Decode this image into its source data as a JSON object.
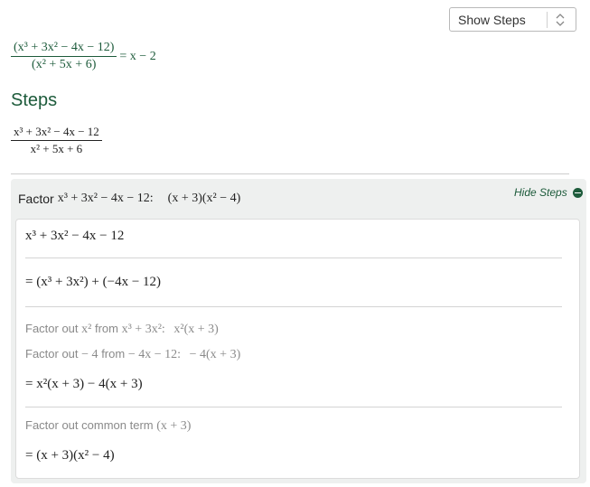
{
  "toolbar": {
    "show_steps_label": "Show Steps"
  },
  "answer": {
    "num": "(x³ + 3x² − 4x − 12)",
    "den": "(x² + 5x + 6)",
    "equals": "= x − 2"
  },
  "steps_title": "Steps",
  "expression": {
    "num": "x³ + 3x² − 4x − 12",
    "den": "x² + 5x + 6"
  },
  "step": {
    "factor_word": "Factor",
    "factor_expr": "x³ + 3x² − 4x − 12:",
    "factor_result": "(x + 3)(x² − 4)",
    "hide_steps_label": "Hide Steps",
    "lines": {
      "l1": "x³ + 3x² − 4x − 12",
      "l2": "= (x³ + 3x²) + (−4x − 12)",
      "n1_word": "Factor out",
      "n1_term": "x²",
      "n1_from": "from",
      "n1_expr": "x³ + 3x²:",
      "n1_result": "x²(x + 3)",
      "n2_word": "Factor out",
      "n2_term": "− 4",
      "n2_from": "from",
      "n2_expr": "− 4x − 12:",
      "n2_result": "− 4(x + 3)",
      "l3": "= x²(x + 3) − 4(x + 3)",
      "n3_word": "Factor out common term",
      "n3_term": "(x + 3)",
      "l4": "= (x + 3)(x² − 4)"
    }
  },
  "colors": {
    "accent": "#1d5b3b",
    "panel_bg": "#eef0ef",
    "muted_text": "#8a8a8a"
  }
}
